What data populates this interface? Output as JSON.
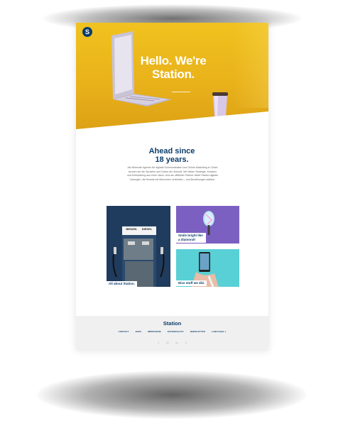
{
  "brand": {
    "logo_letter": "S",
    "accent": "#0c3d6b",
    "hero_yellow": "#f0c21f"
  },
  "hero": {
    "title": "Hello. We're Station."
  },
  "about": {
    "title": "Ahead since 18 years.",
    "text": "Als führende Agentur für digitale Kommunikation und Online-Marketing in Zürich kennen wir die Sprache und Codes der Zukunft. Wir bieten Strategie, Kreation und Entwicklung aus einer Hand. Und als offizieller Partner bietet Station digitale Lösungen, die Brands mit Menschen verbinden – und Beziehungen stärken."
  },
  "tiles": {
    "about_label": "All about Station.",
    "diamond_label": "Smile bright like a diamond!",
    "work_label": "Nice stuff we did.",
    "pump_left": "BENZIN",
    "pump_right": "DIESEL"
  },
  "footer": {
    "brand": "Station",
    "nav": [
      "CONTACT",
      "JOBS",
      "IMPRESSUM",
      "DATENSCHUTZ",
      "NEWSLETTER",
      "LANGUAGE"
    ],
    "language_chevron": "v",
    "socials": [
      "facebook-icon",
      "instagram-icon",
      "linkedin-icon",
      "vimeo-icon"
    ]
  }
}
